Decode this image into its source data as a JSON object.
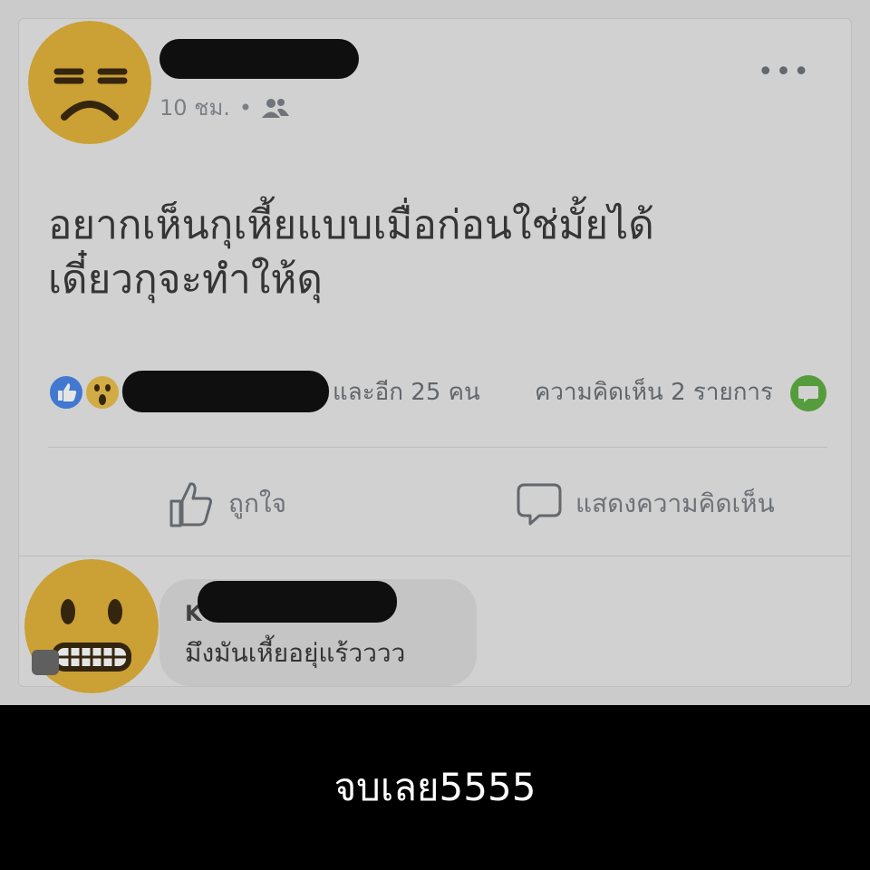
{
  "post": {
    "timestamp": "10 ชม.",
    "separator": "•",
    "audience_icon": "friends-icon",
    "more_label": "•••",
    "text_line1": "อยากเห็นกุเหี้ยแบบเมื่อก่อนใช่มั้ยได้",
    "text_line2": "เดี๋ยวกุจะทำให้ดุ"
  },
  "reactions": {
    "icons": [
      "like-reaction-icon",
      "wow-reaction-icon"
    ],
    "others": "และอีก 25 คน",
    "comment_count": "ความคิดเห็น 2 รายการ"
  },
  "actions": {
    "like_label": "ถูกใจ",
    "comment_label": "แสดงความคิดเห็น"
  },
  "comment": {
    "author_visible": "K",
    "text": "มึงมันเหี้ยอยุ่แร้วววว"
  },
  "caption": {
    "text": "จบเลย5555"
  },
  "colors": {
    "avatar_yellow": "#e2b33a",
    "like_blue": "#4a86e8",
    "comment_green": "#5fae44"
  }
}
